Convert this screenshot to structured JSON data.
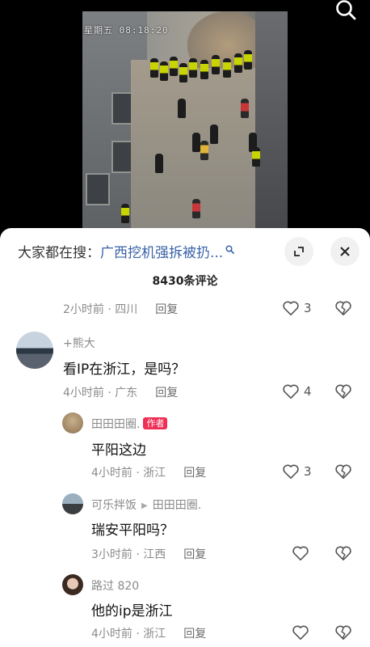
{
  "video": {
    "overlay_text": "星期五 08:18:20"
  },
  "header": {
    "search_prefix": "大家都在搜：",
    "search_term": "广西挖机强拆被扔...",
    "comment_count": "8430条评论"
  },
  "comments": [
    {
      "id": "c0",
      "location": "2小时前 · 四川",
      "reply": "回复",
      "likes": "3"
    },
    {
      "id": "c1",
      "username": "+熊大",
      "text": "看IP在浙江，是吗？",
      "location": "4小时前 · 广东",
      "reply": "回复",
      "likes": "4"
    },
    {
      "id": "c2",
      "username": "田田田圈.",
      "badge": "作者",
      "text": "平阳这边",
      "location": "4小时前 · 浙江",
      "reply": "回复",
      "likes": "3"
    },
    {
      "id": "c3",
      "username": "可乐拌饭",
      "reply_to": "田田田圈.",
      "text": "瑞安平阳吗？",
      "location": "3小时前 · 江西",
      "reply": "回复",
      "likes": ""
    },
    {
      "id": "c4",
      "username": "路过 820",
      "text": "他的ip是浙江",
      "location": "4小时前 · 浙江",
      "reply": "回复",
      "likes": ""
    }
  ]
}
